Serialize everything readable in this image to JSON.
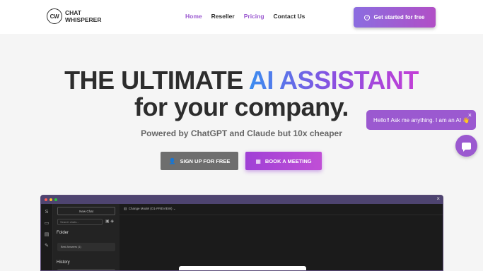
{
  "header": {
    "logo_badge": "CW",
    "logo_line1": "CHAT",
    "logo_line2": "WHISPERER",
    "nav": [
      "Home",
      "Reseller",
      "Pricing",
      "Contact Us"
    ],
    "cta_label": "Get started for free"
  },
  "hero": {
    "headline_part1": "THE ULTIMATE ",
    "headline_highlight": "AI ASSISTANT",
    "headline_line2": "for your company.",
    "subline": "Powered by ChatGPT and Claude but 10x cheaper",
    "signup_label": "SIGN UP FOR FREE",
    "meeting_label": "BOOK A MEETING"
  },
  "chat_widget": {
    "message": "Hello!! Ask me anything. I am an AI 👋",
    "close": "×"
  },
  "app_preview": {
    "close": "×",
    "new_chat": "New Chat",
    "search_placeholder": "Search chats...",
    "folder_label": "Folder",
    "folder_item": "Best Answers (1)",
    "history_label": "History",
    "model_selector": "Change Model (O1-PREVIEW)"
  },
  "colors": {
    "accent": "#9b59d0",
    "cta_gradient_start": "#8b6de0",
    "cta_gradient_end": "#b14fc6",
    "app_bg": "#1b1b1b"
  }
}
